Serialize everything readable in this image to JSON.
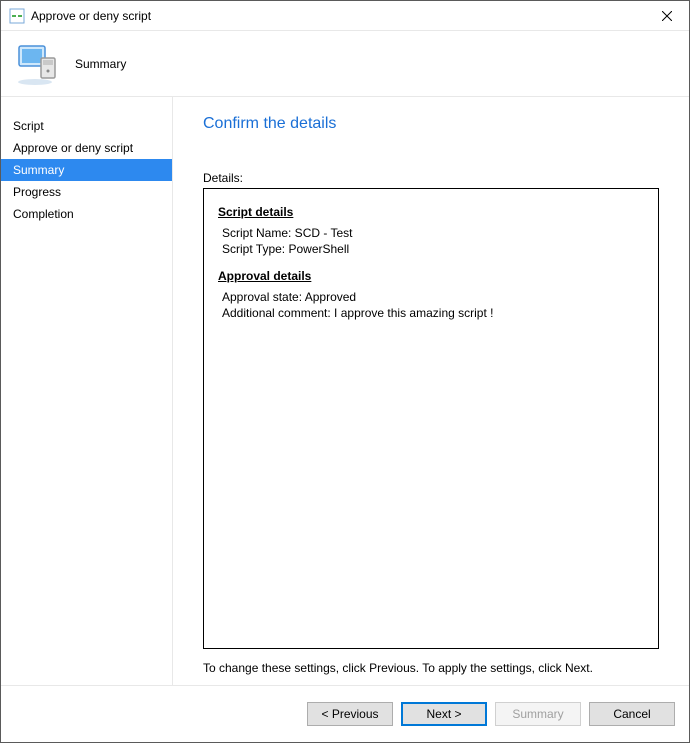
{
  "window": {
    "title": "Approve or deny script"
  },
  "header": {
    "title": "Summary"
  },
  "sidebar": {
    "items": [
      {
        "label": "Script"
      },
      {
        "label": "Approve or deny script"
      },
      {
        "label": "Summary"
      },
      {
        "label": "Progress"
      },
      {
        "label": "Completion"
      }
    ],
    "selectedIndex": 2
  },
  "content": {
    "pageTitle": "Confirm the details",
    "detailsLabel": "Details:",
    "scriptDetailsHeading": "Script details",
    "scriptName": "Script Name: SCD - Test",
    "scriptType": "Script Type: PowerShell",
    "approvalDetailsHeading": "Approval details",
    "approvalState": "Approval state: Approved",
    "additionalComment": "Additional comment: I approve this amazing script !",
    "hint": "To change these settings, click Previous. To apply the settings, click Next."
  },
  "footer": {
    "previous": "< Previous",
    "next": "Next >",
    "summary": "Summary",
    "cancel": "Cancel"
  }
}
